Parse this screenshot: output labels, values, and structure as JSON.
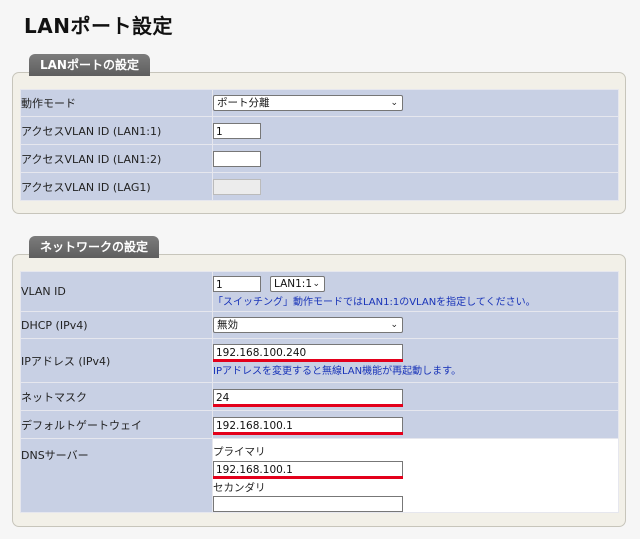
{
  "page": {
    "title": "LANポート設定"
  },
  "lan_section": {
    "title": "LANポートの設定",
    "rows": {
      "mode": {
        "label": "動作モード",
        "value": "ポート分離"
      },
      "vlan_lan11": {
        "label": "アクセスVLAN ID (LAN1:1)",
        "value": "1"
      },
      "vlan_lan12": {
        "label": "アクセスVLAN ID (LAN1:2)",
        "value": ""
      },
      "vlan_lag1": {
        "label": "アクセスVLAN ID (LAG1)",
        "value": ""
      }
    }
  },
  "net_section": {
    "title": "ネットワークの設定",
    "vlan": {
      "label": "VLAN ID",
      "value": "1",
      "port": "LAN1:1",
      "note": "「スイッチング」動作モードではLAN1:1のVLANを指定してください。"
    },
    "dhcp": {
      "label": "DHCP (IPv4)",
      "value": "無効"
    },
    "ip": {
      "label": "IPアドレス (IPv4)",
      "value": "192.168.100.240",
      "note": "IPアドレスを変更すると無線LAN機能が再起動します。"
    },
    "netmask": {
      "label": "ネットマスク",
      "value": "24"
    },
    "gateway": {
      "label": "デフォルトゲートウェイ",
      "value": "192.168.100.1"
    },
    "dns": {
      "label": "DNSサーバー",
      "primary_label": "プライマリ",
      "primary": "192.168.100.1",
      "secondary_label": "セカンダリ",
      "secondary": ""
    }
  },
  "colors": {
    "highlight": "#e3001b",
    "row_bg": "#c8d0e4",
    "note_text": "#1833b8"
  }
}
